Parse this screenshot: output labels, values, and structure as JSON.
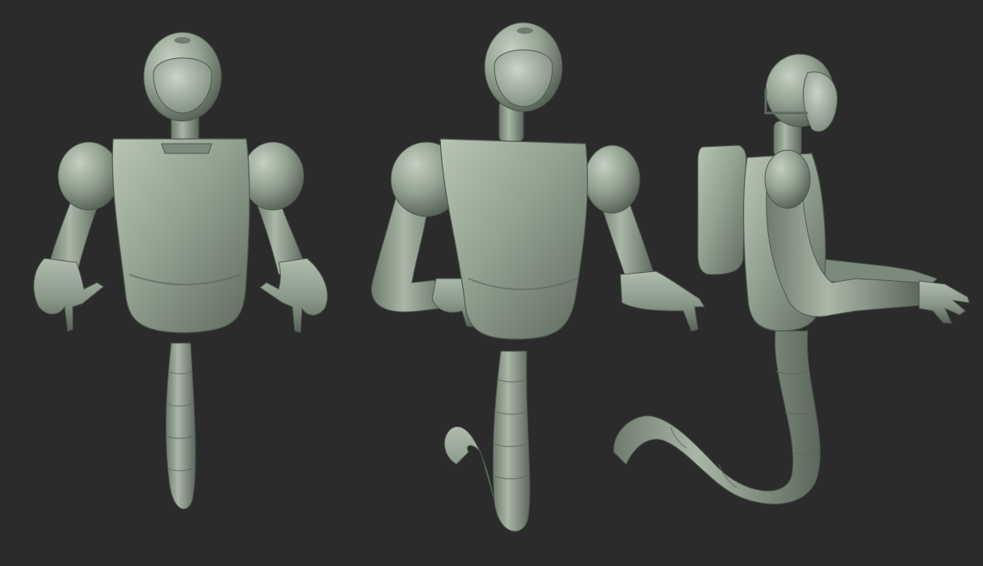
{
  "scene": {
    "background": "#2b2b2c",
    "material_base": "#8e9c8c",
    "material_light": "#b6c3b3",
    "material_mid": "#7b897a",
    "material_shadow": "#4f5a4f",
    "views": [
      {
        "id": "front",
        "icon": "robot-figure-front-view"
      },
      {
        "id": "three-quarter",
        "icon": "robot-figure-three-quarter-view"
      },
      {
        "id": "side",
        "icon": "robot-figure-side-view"
      }
    ]
  }
}
